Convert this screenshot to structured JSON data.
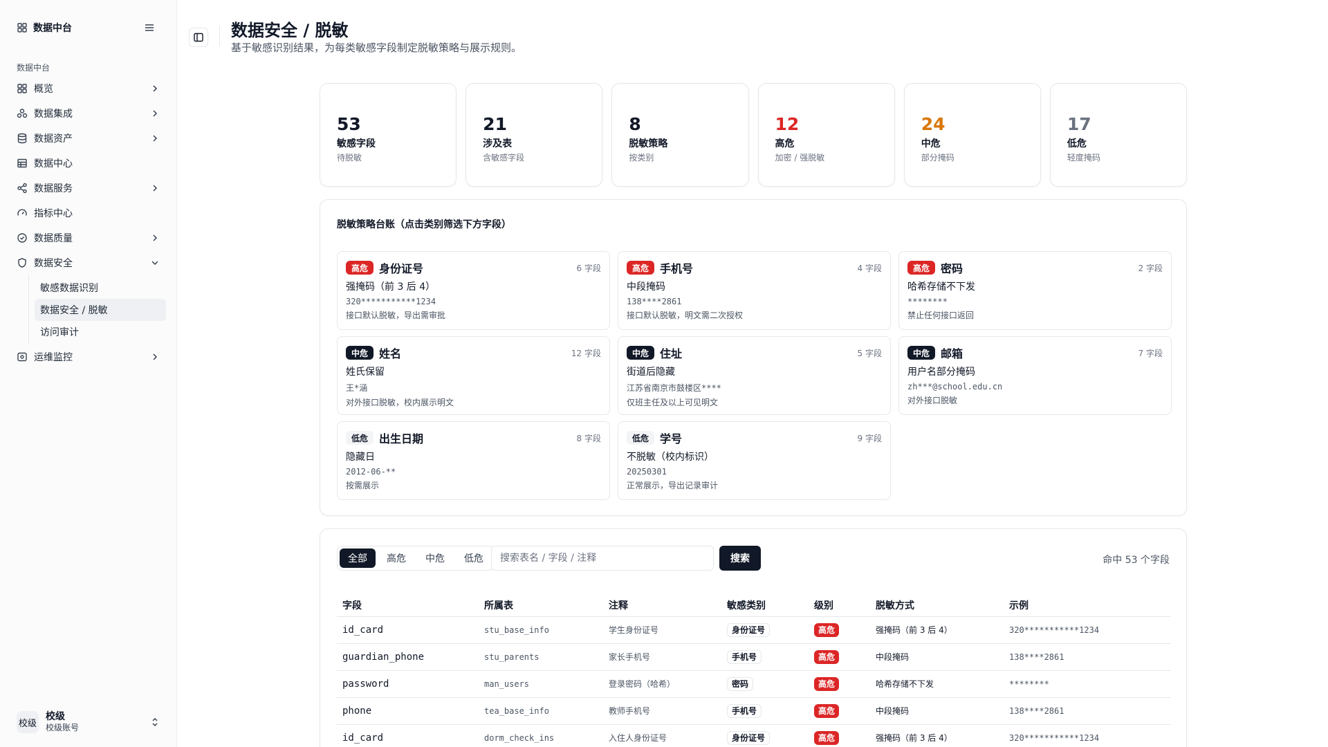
{
  "colors": {
    "high": "#dc2626",
    "mid_value": "#d97706",
    "low_value": "#6b7280",
    "primary": "#111827"
  },
  "sidebar": {
    "brand": "数据中台",
    "section_label": "数据中台",
    "items": [
      {
        "label": "概览",
        "icon": "grid-icon",
        "chevron": "right"
      },
      {
        "label": "数据集成",
        "icon": "integration-icon",
        "chevron": "right"
      },
      {
        "label": "数据资产",
        "icon": "database-icon",
        "chevron": "right"
      },
      {
        "label": "数据中心",
        "icon": "table-icon",
        "chevron": ""
      },
      {
        "label": "数据服务",
        "icon": "share-icon",
        "chevron": "right"
      },
      {
        "label": "指标中心",
        "icon": "gauge-icon",
        "chevron": ""
      },
      {
        "label": "数据质量",
        "icon": "check-circle-icon",
        "chevron": "right"
      },
      {
        "label": "数据安全",
        "icon": "shield-icon",
        "chevron": "down"
      }
    ],
    "security_sub": [
      "敏感数据识别",
      "数据安全 / 脱敏",
      "访问审计"
    ],
    "ops_item": {
      "label": "运维监控",
      "icon": "monitor-icon"
    },
    "account": {
      "avatar": "校级",
      "name": "校级",
      "sub": "校级账号"
    }
  },
  "header": {
    "title": "数据安全 / 脱敏",
    "subtitle": "基于敏感识别结果，为每类敏感字段制定脱敏策略与展示规则。"
  },
  "stats": [
    {
      "value": "53",
      "label": "敏感字段",
      "note": "待脱敏",
      "tone": "default"
    },
    {
      "value": "21",
      "label": "涉及表",
      "note": "含敏感字段",
      "tone": "default"
    },
    {
      "value": "8",
      "label": "脱敏策略",
      "note": "按类别",
      "tone": "default"
    },
    {
      "value": "12",
      "label": "高危",
      "note": "加密 / 强脱敏",
      "tone": "high"
    },
    {
      "value": "24",
      "label": "中危",
      "note": "部分掩码",
      "tone": "mid"
    },
    {
      "value": "17",
      "label": "低危",
      "note": "轻度掩码",
      "tone": "low"
    }
  ],
  "policy": {
    "title": "脱敏策略台账（点击类别筛选下方字段）",
    "cards": [
      {
        "level": "高危",
        "tone": "high",
        "name": "身份证号",
        "count": "6 字段",
        "method": "强掩码（前 3 后 4）",
        "example": "320***********1234",
        "rule": "接口默认脱敏，导出需审批"
      },
      {
        "level": "高危",
        "tone": "high",
        "name": "手机号",
        "count": "4 字段",
        "method": "中段掩码",
        "example": "138****2861",
        "rule": "接口默认脱敏，明文需二次授权"
      },
      {
        "level": "高危",
        "tone": "high",
        "name": "密码",
        "count": "2 字段",
        "method": "哈希存储不下发",
        "example": "********",
        "rule": "禁止任何接口返回"
      },
      {
        "level": "中危",
        "tone": "mid",
        "name": "姓名",
        "count": "12 字段",
        "method": "姓氏保留",
        "example": "王*涵",
        "rule": "对外接口脱敏，校内展示明文"
      },
      {
        "level": "中危",
        "tone": "mid",
        "name": "住址",
        "count": "5 字段",
        "method": "街道后隐藏",
        "example": "江苏省南京市鼓楼区****",
        "rule": "仅班主任及以上可见明文"
      },
      {
        "level": "中危",
        "tone": "mid",
        "name": "邮箱",
        "count": "7 字段",
        "method": "用户名部分掩码",
        "example": "zh***@school.edu.cn",
        "rule": "对外接口脱敏"
      },
      {
        "level": "低危",
        "tone": "low",
        "name": "出生日期",
        "count": "8 字段",
        "method": "隐藏日",
        "example": "2012-06-**",
        "rule": "按需展示"
      },
      {
        "level": "低危",
        "tone": "low",
        "name": "学号",
        "count": "9 字段",
        "method": "不脱敏（校内标识）",
        "example": "20250301",
        "rule": "正常展示，导出记录审计"
      }
    ]
  },
  "filter": {
    "tabs": [
      "全部",
      "高危",
      "中危",
      "低危"
    ],
    "active_tab": 0,
    "search_placeholder": "搜索表名 / 字段 / 注释",
    "search_value": "",
    "search_button": "搜索",
    "hit_count": "命中 53 个字段"
  },
  "table": {
    "columns": [
      "字段",
      "所属表",
      "注释",
      "敏感类别",
      "级别",
      "脱敏方式",
      "示例"
    ],
    "rows": [
      {
        "field": "id_card",
        "table": "stu_base_info",
        "comment": "学生身份证号",
        "category": "身份证号",
        "level": "高危",
        "method": "强掩码（前 3 后 4）",
        "example": "320***********1234"
      },
      {
        "field": "guardian_phone",
        "table": "stu_parents",
        "comment": "家长手机号",
        "category": "手机号",
        "level": "高危",
        "method": "中段掩码",
        "example": "138****2861"
      },
      {
        "field": "password",
        "table": "man_users",
        "comment": "登录密码（哈希）",
        "category": "密码",
        "level": "高危",
        "method": "哈希存储不下发",
        "example": "********"
      },
      {
        "field": "phone",
        "table": "tea_base_info",
        "comment": "教师手机号",
        "category": "手机号",
        "level": "高危",
        "method": "中段掩码",
        "example": "138****2861"
      },
      {
        "field": "id_card",
        "table": "dorm_check_ins",
        "comment": "入住人身份证号",
        "category": "身份证号",
        "level": "高危",
        "method": "强掩码（前 3 后 4）",
        "example": "320***********1234"
      }
    ]
  }
}
